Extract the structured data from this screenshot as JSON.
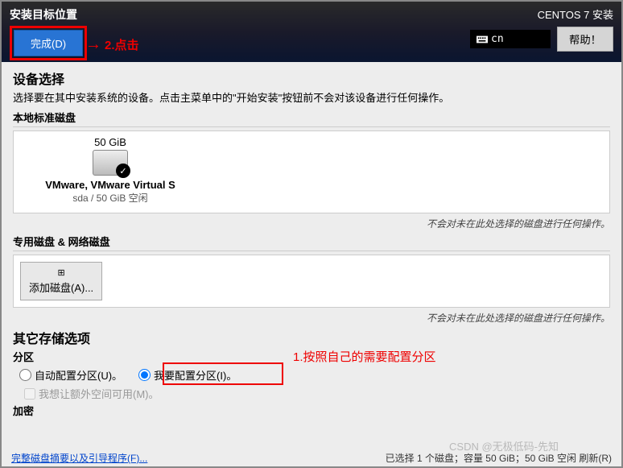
{
  "header": {
    "title": "安装目标位置",
    "done_label": "完成(D)",
    "installer": "CENTOS 7 安装",
    "lang": "cn",
    "help": "帮助！"
  },
  "annotation": {
    "step2": "2.点击",
    "step1": "1.按照自己的需要配置分区"
  },
  "device": {
    "heading": "设备选择",
    "desc": "选择要在其中安装系统的设备。点击主菜单中的\"开始安装\"按钮前不会对该设备进行任何操作。",
    "local_label": "本地标准磁盘",
    "size": "50 GiB",
    "name": "VMware, VMware Virtual S",
    "info": "sda   /   50 GiB 空闲",
    "hint": "不会对未在此处选择的磁盘进行任何操作。",
    "special_label": "专用磁盘 & 网络磁盘",
    "add_disk": "添加磁盘(A)..."
  },
  "storage": {
    "heading": "其它存储选项",
    "partition_label": "分区",
    "auto": "自动配置分区(U)。",
    "manual": "我要配置分区(I)。",
    "extra_space": "我想让额外空间可用(M)。",
    "encrypt_label": "加密"
  },
  "footer": {
    "link": "完整磁盘摘要以及引导程序(F)...",
    "status": "已选择 1 个磁盘；容量 50 GiB；50 GiB 空闲   刷新(R)"
  },
  "watermark": "CSDN @无极低码-先知"
}
